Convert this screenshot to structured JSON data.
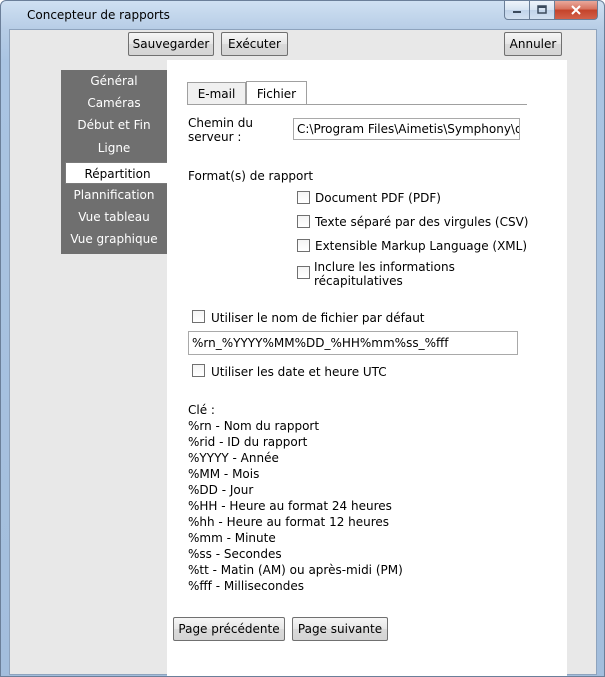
{
  "window": {
    "title": "Concepteur de rapports",
    "controls": [
      "minimize-icon",
      "maximize-icon",
      "close-icon"
    ]
  },
  "toolbar": {
    "save_label": "Sauvegarder",
    "run_label": "Exécuter",
    "cancel_label": "Annuler"
  },
  "sidebar": {
    "items": [
      {
        "label": "Général"
      },
      {
        "label": "Caméras"
      },
      {
        "label": "Début et Fin"
      },
      {
        "label": "Ligne"
      },
      {
        "label": "Répartition",
        "active": true
      },
      {
        "label": "Plannification"
      },
      {
        "label": "Vue tableau"
      },
      {
        "label": "Vue graphique"
      }
    ]
  },
  "tabs": [
    {
      "label": "E-mail"
    },
    {
      "label": "Fichier",
      "active": true
    }
  ],
  "file": {
    "server_path_label": "Chemin du serveur :",
    "server_path_line1": "Chemin du",
    "server_path_line2": "serveur :",
    "server_path_value": "C:\\Program Files\\Aimetis\\Symphony\\d",
    "formats_label": "Format(s) de rapport",
    "formats": [
      {
        "label": "Document PDF (PDF)",
        "checked": false
      },
      {
        "label": "Texte séparé par des virgules (CSV)",
        "checked": false
      },
      {
        "label": "Extensible Markup Language (XML)",
        "checked": false
      }
    ],
    "include_summary_line1": "Inclure les informations",
    "include_summary_line2": "récapitulatives",
    "include_summary_checked": false,
    "default_filename_label": "Utiliser le nom de fichier par défaut",
    "default_filename_checked": false,
    "filename_pattern": "%rn_%YYYY%MM%DD_%HH%mm%ss_%fff",
    "utc_label": "Utiliser les date et heure UTC",
    "utc_checked": false
  },
  "key": {
    "title": "Clé :",
    "entries": [
      "%rn - Nom du rapport",
      "%rid - ID du rapport",
      "%YYYY - Année",
      "%MM - Mois",
      "%DD - Jour",
      "%HH - Heure au format 24 heures",
      "%hh - Heure au format 12 heures",
      "%mm - Minute",
      "%ss - Secondes",
      "%tt - Matin (AM) ou après-midi (PM)",
      "%fff - Millisecondes"
    ]
  },
  "footer": {
    "prev_label": "Page précédente",
    "next_label": "Page suivante"
  }
}
